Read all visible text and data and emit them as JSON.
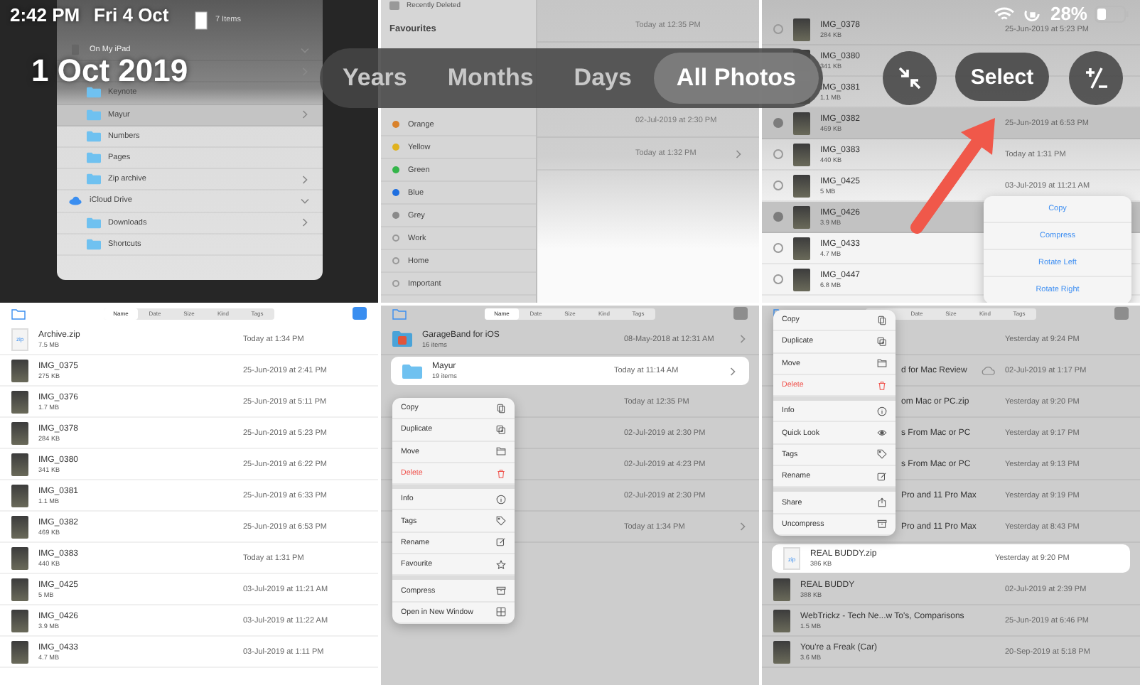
{
  "status_bar": {
    "time": "2:42 PM",
    "date": "Fri 4 Oct",
    "battery": "28%"
  },
  "header": {
    "title": "1 Oct 2019",
    "select_button": "Select",
    "view_tabs": [
      {
        "label": "Years",
        "selected": false
      },
      {
        "label": "Months",
        "selected": false
      },
      {
        "label": "Days",
        "selected": false
      },
      {
        "label": "All Photos",
        "selected": true
      }
    ]
  },
  "screenshots": [
    {
      "kind": "sidebar_popup",
      "header": "7 Items",
      "items": [
        {
          "kind": "section",
          "label": "On My iPad",
          "expanded": true,
          "selected": false
        },
        {
          "kind": "folder",
          "chevron": true,
          "selected": false
        },
        {
          "kind": "folder",
          "label": "Keynote",
          "chevron": false,
          "selected": false
        },
        {
          "kind": "folder",
          "label": "Mayur",
          "chevron": true,
          "selected": true
        },
        {
          "kind": "folder",
          "label": "Numbers",
          "chevron": false,
          "selected": false
        },
        {
          "kind": "folder",
          "label": "Pages",
          "chevron": false,
          "selected": false
        },
        {
          "kind": "folder",
          "label": "Zip archive",
          "chevron": true,
          "selected": false
        },
        {
          "kind": "section",
          "label": "iCloud Drive",
          "expanded": true,
          "selected": false
        },
        {
          "kind": "folder",
          "label": "Downloads",
          "chevron": true,
          "selected": false
        },
        {
          "kind": "folder",
          "label": "Shortcuts",
          "chevron": false,
          "selected": false
        }
      ]
    },
    {
      "kind": "tags_sidebar",
      "top_item": "Recently Deleted",
      "section": "Favourites",
      "tags": [
        {
          "label": "Orange",
          "color": "#d9822b"
        },
        {
          "label": "Yellow",
          "color": "#e0b21e"
        },
        {
          "label": "Green",
          "color": "#34b54a"
        },
        {
          "label": "Blue",
          "color": "#1f6fe0"
        },
        {
          "label": "Grey",
          "color": "#8a8a8a"
        },
        {
          "label": "Work"
        },
        {
          "label": "Home"
        },
        {
          "label": "Important"
        }
      ],
      "dates": [
        {
          "text": "Today at 12:35 PM",
          "chevron": false
        },
        {
          "text": "02-Jul-2019 at 2:30 PM",
          "chevron": false
        },
        {
          "text": "Today at 1:32 PM",
          "chevron": true
        }
      ]
    },
    {
      "kind": "file_list",
      "rows": [
        {
          "kind": "image",
          "name": "IMG_0378",
          "size": "284 KB",
          "date": "25-Jun-2019 at 5:23 PM",
          "checked": false
        },
        {
          "kind": "image",
          "name": "IMG_0380",
          "size": "341 KB"
        },
        {
          "kind": "image",
          "name": "IMG_0381",
          "size": "1.1 MB"
        },
        {
          "kind": "image",
          "name": "IMG_0382",
          "size": "469 KB",
          "date": "25-Jun-2019 at 6:53 PM",
          "checked": true
        },
        {
          "kind": "image",
          "name": "IMG_0383",
          "size": "440 KB",
          "date": "Today at 1:31 PM",
          "checked": false
        },
        {
          "kind": "image",
          "name": "IMG_0425",
          "size": "5 MB",
          "date": "03-Jul-2019 at 11:21 AM",
          "checked": false
        },
        {
          "kind": "image",
          "name": "IMG_0426",
          "size": "3.9 MB",
          "checked": true
        },
        {
          "kind": "image",
          "name": "IMG_0433",
          "size": "4.7 MB",
          "checked": false
        },
        {
          "kind": "image",
          "name": "IMG_0447",
          "size": "6.8 MB",
          "checked": false
        }
      ],
      "menu": {
        "kind": "action",
        "groups": [
          [
            {
              "label": "Copy"
            },
            {
              "label": "Compress"
            },
            {
              "label": "Rotate Left"
            },
            {
              "label": "Rotate Right"
            }
          ]
        ]
      }
    },
    {
      "kind": "file_list",
      "sort_tabs": [
        {
          "label": "Name",
          "selected": true
        },
        {
          "label": "Date",
          "selected": false
        },
        {
          "label": "Size",
          "selected": false
        },
        {
          "label": "Kind",
          "selected": false
        },
        {
          "label": "Tags",
          "selected": false
        }
      ],
      "rows": [
        {
          "kind": "zip",
          "badge": "zip",
          "name": "Archive.zip",
          "size": "7.5 MB",
          "date": "Today at 1:34 PM"
        },
        {
          "kind": "image",
          "name": "IMG_0375",
          "size": "275 KB",
          "date": "25-Jun-2019 at 2:41 PM"
        },
        {
          "kind": "image",
          "name": "IMG_0376",
          "size": "1.7 MB",
          "date": "25-Jun-2019 at 5:11 PM"
        },
        {
          "kind": "image",
          "name": "IMG_0378",
          "size": "284 KB",
          "date": "25-Jun-2019 at 5:23 PM"
        },
        {
          "kind": "image",
          "name": "IMG_0380",
          "size": "341 KB",
          "date": "25-Jun-2019 at 6:22 PM"
        },
        {
          "kind": "image",
          "name": "IMG_0381",
          "size": "1.1 MB",
          "date": "25-Jun-2019 at 6:33 PM"
        },
        {
          "kind": "image",
          "name": "IMG_0382",
          "size": "469 KB",
          "date": "25-Jun-2019 at 6:53 PM"
        },
        {
          "kind": "image",
          "name": "IMG_0383",
          "size": "440 KB",
          "date": "Today at 1:31 PM"
        },
        {
          "kind": "image",
          "name": "IMG_0425",
          "size": "5 MB",
          "date": "03-Jul-2019 at 11:21 AM"
        },
        {
          "kind": "image",
          "name": "IMG_0426",
          "size": "3.9 MB",
          "date": "03-Jul-2019 at 11:22 AM"
        },
        {
          "kind": "image",
          "name": "IMG_0433",
          "size": "4.7 MB",
          "date": "03-Jul-2019 at 1:11 PM"
        }
      ]
    },
    {
      "kind": "file_list",
      "sort_tabs": [
        {
          "label": "Name",
          "selected": true
        },
        {
          "label": "Date",
          "selected": false
        },
        {
          "label": "Size",
          "selected": false
        },
        {
          "label": "Kind",
          "selected": false
        },
        {
          "label": "Tags",
          "selected": false
        }
      ],
      "rows": [
        {
          "kind": "app_folder",
          "name": "GarageBand for iOS",
          "size": "16 items",
          "date": "08-May-2018 at 12:31 AM",
          "chevron": true,
          "lifted": false
        },
        {
          "kind": "folder",
          "name": "Mayur",
          "size": "19 items",
          "date": "Today at 11:14 AM",
          "chevron": true,
          "lifted": true
        },
        {
          "kind": "blank",
          "date": "Today at 12:35 PM",
          "chevron": false,
          "lifted": false
        },
        {
          "kind": "blank",
          "date": "02-Jul-2019 at 2:30 PM",
          "chevron": false,
          "lifted": false
        },
        {
          "kind": "blank",
          "date": "02-Jul-2019 at 4:23 PM",
          "chevron": false,
          "lifted": false
        },
        {
          "kind": "blank",
          "date": "02-Jul-2019 at 2:30 PM",
          "chevron": false,
          "lifted": false
        },
        {
          "kind": "blank",
          "date": "Today at 1:34 PM",
          "chevron": true,
          "lifted": false
        }
      ],
      "menu": {
        "kind": "context",
        "groups": [
          [
            {
              "label": "Copy",
              "kind": "copy"
            },
            {
              "label": "Duplicate",
              "kind": "duplicate"
            },
            {
              "label": "Move",
              "kind": "move"
            },
            {
              "label": "Delete",
              "kind": "delete"
            }
          ],
          [
            {
              "label": "Info",
              "kind": "info"
            },
            {
              "label": "Tags",
              "kind": "tags"
            },
            {
              "label": "Rename",
              "kind": "rename"
            },
            {
              "label": "Favourite",
              "kind": "favourite"
            }
          ],
          [
            {
              "label": "Compress",
              "kind": "compress"
            },
            {
              "label": "Open in New Window",
              "kind": "window"
            }
          ]
        ]
      }
    },
    {
      "kind": "file_list",
      "sort_tabs": [
        {
          "label": "Date",
          "selected": false
        },
        {
          "label": "Size",
          "selected": false
        },
        {
          "label": "Kind",
          "selected": false
        },
        {
          "label": "Tags",
          "selected": false
        }
      ],
      "rows": [
        {
          "kind": "partial",
          "date": "Yesterday at 9:24 PM",
          "lifted": false,
          "in_cloud": false
        },
        {
          "kind": "partial",
          "name": "d for Mac Review",
          "date": "02-Jul-2019 at 1:17 PM",
          "lifted": false,
          "in_cloud": true
        },
        {
          "kind": "partial",
          "name": "om Mac or PC.zip",
          "date": "Yesterday at 9:20 PM",
          "lifted": false,
          "in_cloud": false
        },
        {
          "kind": "partial",
          "name": "s From Mac or PC",
          "date": "Yesterday at 9:17 PM",
          "lifted": false,
          "in_cloud": false
        },
        {
          "kind": "partial",
          "name": "s From Mac or PC",
          "date": "Yesterday at 9:13 PM",
          "lifted": false,
          "in_cloud": false
        },
        {
          "kind": "partial",
          "name": "Pro and 11 Pro Max",
          "date": "Yesterday at 9:19 PM",
          "lifted": false,
          "in_cloud": false
        },
        {
          "kind": "partial",
          "name": "Pro and 11 Pro Max",
          "date": "Yesterday at 8:43 PM",
          "lifted": false,
          "in_cloud": false
        },
        {
          "kind": "zip",
          "badge": "zip",
          "name": "REAL BUDDY.zip",
          "size": "386 KB",
          "date": "Yesterday at 9:20 PM",
          "lifted": true,
          "in_cloud": false
        },
        {
          "kind": "image",
          "name": "REAL BUDDY",
          "size": "388 KB",
          "date": "02-Jul-2019 at 2:39 PM",
          "lifted": false,
          "in_cloud": false
        },
        {
          "kind": "image",
          "name": "WebTrickz - Tech Ne...w To's, Comparisons",
          "size": "1.5 MB",
          "date": "25-Jun-2019 at 6:46 PM",
          "lifted": false,
          "in_cloud": false
        },
        {
          "kind": "image",
          "name": "You're a Freak (Car)",
          "size": "3.6 MB",
          "date": "20-Sep-2019 at 5:18 PM",
          "lifted": false,
          "in_cloud": false
        }
      ],
      "menu": {
        "kind": "context",
        "groups": [
          [
            {
              "label": "Copy",
              "kind": "copy"
            },
            {
              "label": "Duplicate",
              "kind": "duplicate"
            },
            {
              "label": "Move",
              "kind": "move"
            },
            {
              "label": "Delete",
              "kind": "delete"
            }
          ],
          [
            {
              "label": "Info",
              "kind": "info"
            },
            {
              "label": "Quick Look",
              "kind": "look"
            },
            {
              "label": "Tags",
              "kind": "tags"
            },
            {
              "label": "Rename",
              "kind": "rename"
            }
          ],
          [
            {
              "label": "Share",
              "kind": "share"
            },
            {
              "label": "Uncompress",
              "kind": "uncompress"
            }
          ]
        ]
      }
    }
  ]
}
